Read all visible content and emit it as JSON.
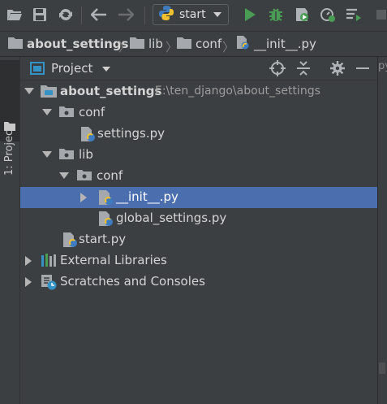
{
  "toolbar": {
    "run_config": "start"
  },
  "breadcrumb": {
    "items": [
      "about_settings",
      "lib",
      "conf",
      "__init__.py"
    ]
  },
  "sidebar": {
    "tab_label": "1: Project"
  },
  "panel": {
    "title": "Project"
  },
  "tree": {
    "root": {
      "label": "about_settings",
      "path": "E:\\ten_django\\about_settings"
    },
    "conf": "conf",
    "settings": "settings.py",
    "lib": "lib",
    "lib_conf": "conf",
    "init": "__init__.py",
    "global_settings": "global_settings.py",
    "start": "start.py",
    "external": "External Libraries",
    "scratches": "Scratches and Consoles"
  },
  "right_edge": {
    "fragment": "py"
  },
  "colors": {
    "background": "#3c3f41",
    "selection": "#4b6eaf",
    "run_green": "#499c54",
    "python_blue": "#3e7bbf",
    "python_yellow": "#f0c02f"
  }
}
